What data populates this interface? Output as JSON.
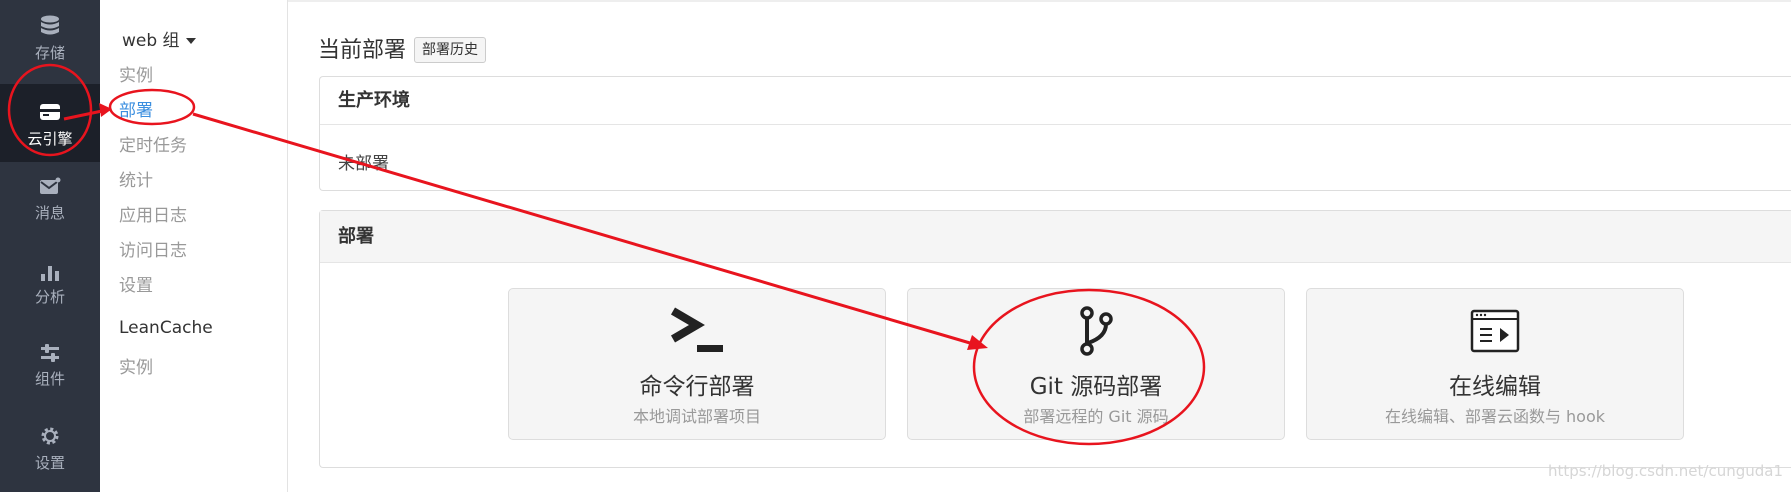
{
  "rail": {
    "items": [
      {
        "label": "存储",
        "icon": "database-icon"
      },
      {
        "label": "云引擎",
        "icon": "engine-card-icon",
        "active": true
      },
      {
        "label": "消息",
        "icon": "message-icon"
      },
      {
        "label": "分析",
        "icon": "bar-chart-icon"
      },
      {
        "label": "组件",
        "icon": "sliders-icon"
      },
      {
        "label": "设置",
        "icon": "gear-icon"
      }
    ]
  },
  "subnav": {
    "group_label": "web 组",
    "items": [
      "实例",
      "部署",
      "定时任务",
      "统计",
      "应用日志",
      "访问日志",
      "设置"
    ],
    "section2_title": "LeanCache",
    "section2_items": [
      "实例"
    ]
  },
  "main": {
    "title": "当前部署",
    "history_button": "部署历史",
    "prod_panel": {
      "title": "生产环境",
      "status": "未部署"
    },
    "deploy_panel": {
      "title": "部署",
      "cards": [
        {
          "title": "命令行部署",
          "desc": "本地调试部署项目",
          "icon": "terminal-prompt-icon"
        },
        {
          "title": "Git 源码部署",
          "desc": "部署远程的 Git 源码",
          "icon": "git-branch-icon"
        },
        {
          "title": "在线编辑",
          "desc": "在线编辑、部署云函数与 hook",
          "icon": "online-editor-icon"
        }
      ]
    }
  },
  "watermark": "https://blog.csdn.net/cunguda1",
  "colors": {
    "rail_bg": "#2e3440",
    "accent": "#3b8fe0",
    "annotation": "#e8141e"
  }
}
